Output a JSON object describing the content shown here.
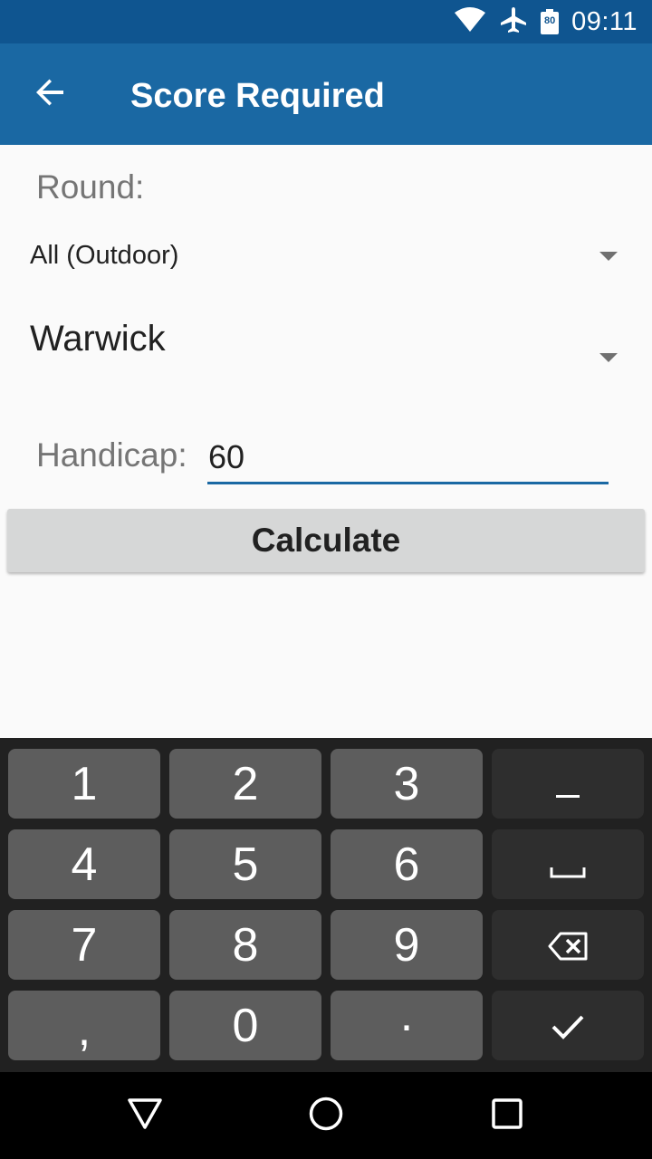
{
  "status_bar": {
    "time": "09:11",
    "battery_level": "80",
    "icons": [
      "wifi-icon",
      "airplane-mode-icon",
      "battery-icon"
    ]
  },
  "app_bar": {
    "title": "Score Required",
    "back_icon": "arrow-left-icon",
    "background_color": "#1a68a3"
  },
  "form": {
    "round_label": "Round:",
    "category_selected": "All (Outdoor)",
    "round_selected": "Warwick",
    "handicap_label": "Handicap:",
    "handicap_value": "60",
    "calculate_label": "Calculate"
  },
  "keyboard": {
    "keys": [
      {
        "label": "1",
        "name": "key-1"
      },
      {
        "label": "2",
        "name": "key-2"
      },
      {
        "label": "3",
        "name": "key-3"
      },
      {
        "label": "−",
        "name": "key-minus"
      },
      {
        "label": "4",
        "name": "key-4"
      },
      {
        "label": "5",
        "name": "key-5"
      },
      {
        "label": "6",
        "name": "key-6"
      },
      {
        "label": "␣",
        "name": "key-space"
      },
      {
        "label": "7",
        "name": "key-7"
      },
      {
        "label": "8",
        "name": "key-8"
      },
      {
        "label": "9",
        "name": "key-9"
      },
      {
        "label": "⌫",
        "name": "key-backspace"
      },
      {
        "label": ",",
        "name": "key-comma"
      },
      {
        "label": "0",
        "name": "key-0"
      },
      {
        "label": ".",
        "name": "key-dot"
      },
      {
        "label": "✓",
        "name": "key-done"
      }
    ]
  },
  "nav_bar": {
    "icons": [
      "back-triangle-icon",
      "home-circle-icon",
      "recents-square-icon"
    ]
  }
}
